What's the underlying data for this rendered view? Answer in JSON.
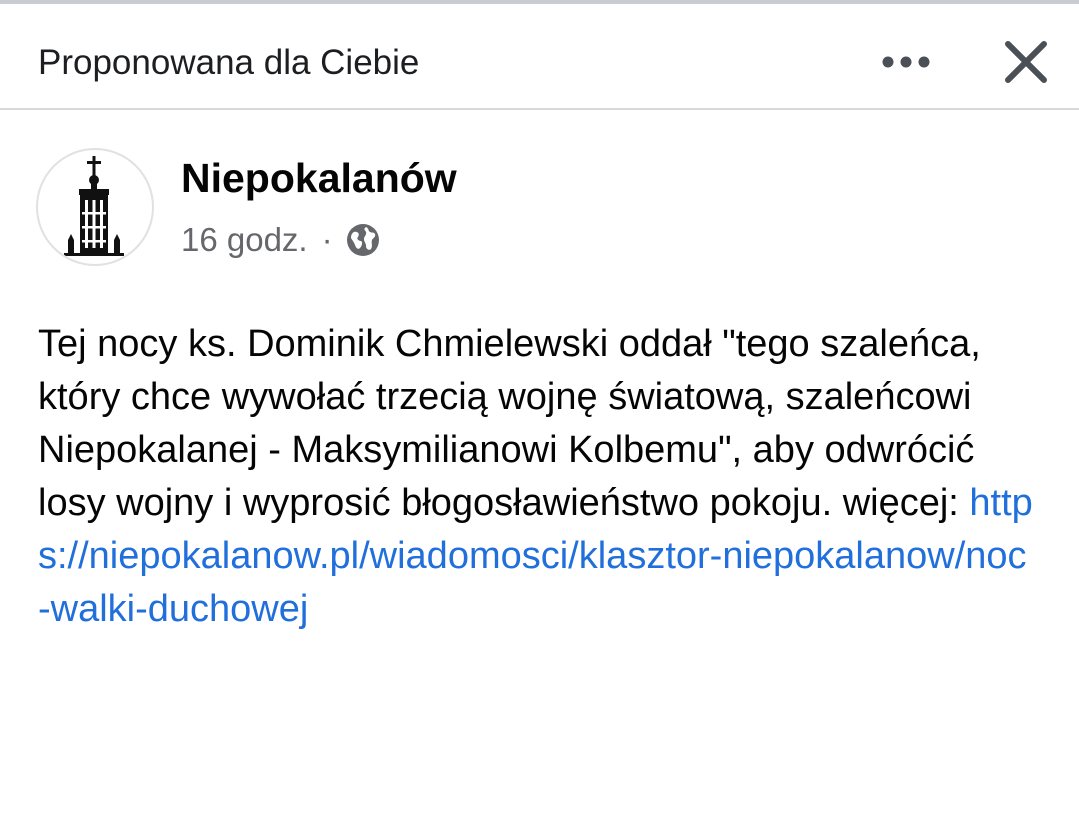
{
  "header": {
    "title": "Proponowana dla Ciebie",
    "more_icon": "more-horizontal-icon",
    "close_icon": "close-icon"
  },
  "post": {
    "author": "Niepokalanów",
    "avatar_icon": "church-tower-logo",
    "time": "16 godz.",
    "separator": "·",
    "audience_icon": "globe-icon",
    "text": "Tej nocy ks. Dominik Chmielewski oddał \"tego szaleńca, który chce wywołać trzecią wojnę światową, szaleńcowi Niepokalanej - Maksymilianowi Kolbemu\", aby odwrócić losy wojny i wyprosić błogosławieństwo pokoju. więcej: ",
    "link": "https://niepokalanow.pl/wiadomosci/klasztor-niepokalanow/noc-walki-duchowej"
  },
  "colors": {
    "link": "#216fdb",
    "meta_text": "#65676b",
    "divider": "#d6d8dc"
  }
}
